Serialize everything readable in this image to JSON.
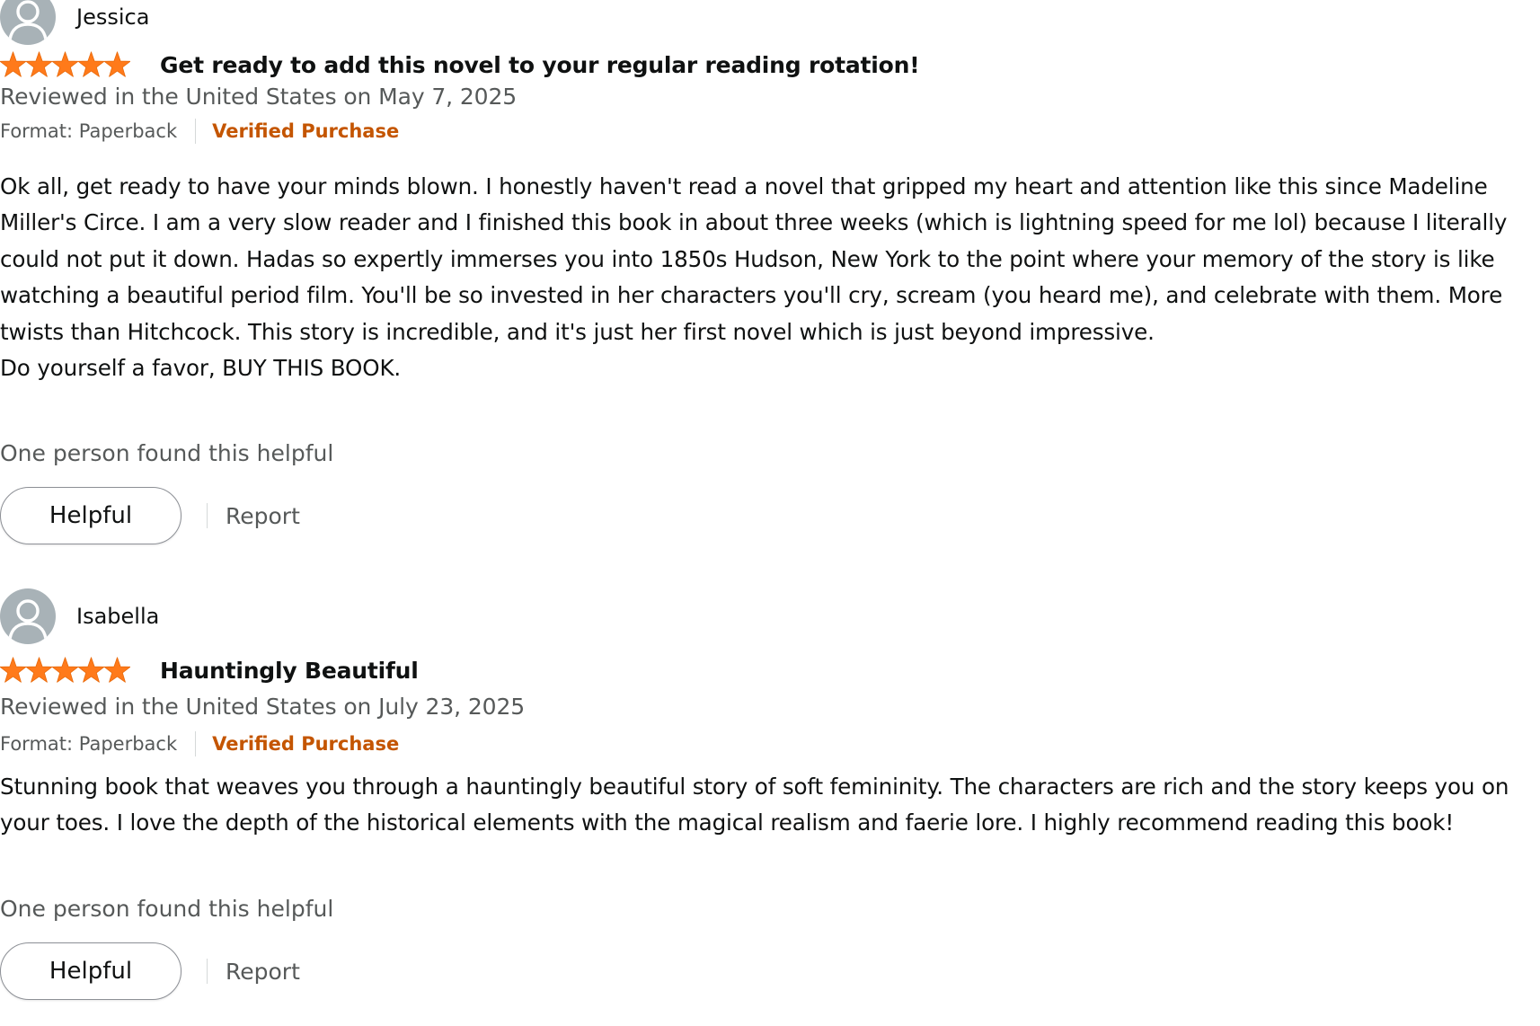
{
  "colors": {
    "star": "#ff7a1a",
    "verified": "#c45500",
    "secondary_text": "#565959",
    "primary_text": "#0f1111",
    "avatar_bg": "#a8b2b7"
  },
  "reviews": [
    {
      "reviewer": "Jessica",
      "rating": 5,
      "rating_max": 5,
      "title": "Get ready to add this novel to your regular reading rotation!",
      "date": "Reviewed in the United States on May 7, 2025",
      "format": "Format: Paperback",
      "verified": "Verified Purchase",
      "body": [
        "Ok all, get ready to have your minds blown. I honestly haven't read a novel that gripped my heart and attention like this since Madeline Miller's Circe. I am a very slow reader and I finished this book in about three weeks (which is lightning speed for me lol) because I literally could not put it down. Hadas so expertly immerses you into 1850s Hudson, New York to the point where your memory of the story is like watching a beautiful period film. You'll be so invested in her characters you'll cry, scream (you heard me), and celebrate with them. More twists than Hitchcock. This story is incredible, and it's just her first novel which is just beyond impressive.",
        "Do yourself a favor, BUY THIS BOOK."
      ],
      "helpful_count": "One person found this helpful",
      "helpful_label": "Helpful",
      "report_label": "Report"
    },
    {
      "reviewer": "Isabella",
      "rating": 5,
      "rating_max": 5,
      "title": "Hauntingly Beautiful",
      "date": "Reviewed in the United States on July 23, 2025",
      "format": "Format: Paperback",
      "verified": "Verified Purchase",
      "body": [
        "Stunning book that weaves you through a hauntingly beautiful story of soft femininity. The characters are rich and the story keeps you on your toes. I love the depth of the historical elements with the magical realism and faerie lore. I highly recommend reading this book!"
      ],
      "helpful_count": "One person found this helpful",
      "helpful_label": "Helpful",
      "report_label": "Report"
    }
  ]
}
